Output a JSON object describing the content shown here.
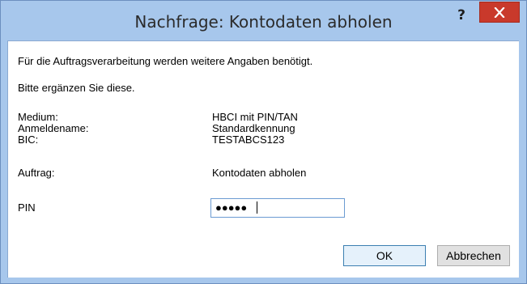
{
  "window": {
    "title": "Nachfrage: Kontodaten abholen",
    "help_label": "?",
    "close_icon": "close-icon",
    "accent_color": "#a7c7ec",
    "close_color": "#c9392b"
  },
  "messages": {
    "line1": "Für die Auftragsverarbeitung werden weitere Angaben benötigt.",
    "line2": "Bitte ergänzen Sie diese."
  },
  "details": {
    "medium_label": "Medium:",
    "medium_value": "HBCI mit PIN/TAN",
    "login_label": "Anmeldename:",
    "login_value": "Standardkennung",
    "bic_label": "BIC:",
    "bic_value": "TESTABCS123",
    "order_label": "Auftrag:",
    "order_value": "Kontodaten abholen"
  },
  "pin": {
    "label": "PIN",
    "masked_value": "●●●●●"
  },
  "buttons": {
    "ok": "OK",
    "cancel": "Abbrechen"
  }
}
